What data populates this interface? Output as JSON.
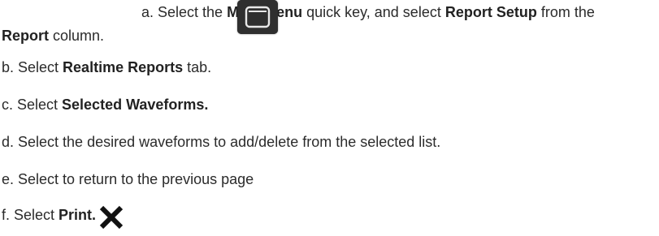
{
  "steps": {
    "a": {
      "prefix": "a. Select the ",
      "bold1": "Main Menu",
      "mid": " quick key, and select ",
      "bold2": "Report Setup",
      "suffix": " from the",
      "line2_bold": "Report",
      "line2_suffix": " column."
    },
    "b": {
      "prefix": "b. Select ",
      "bold": "Realtime Reports",
      "suffix": " tab."
    },
    "c": {
      "prefix": "c. Select ",
      "bold": "Selected Waveforms."
    },
    "d": {
      "text": "d. Select the desired waveforms to add/delete from the selected list."
    },
    "e": {
      "text": "e. Select to return to the previous page"
    },
    "f": {
      "prefix": "f. Select ",
      "bold": "Print."
    }
  },
  "icons": {
    "main_menu": "main-menu-quick-key-icon",
    "close": "close-x-icon"
  }
}
